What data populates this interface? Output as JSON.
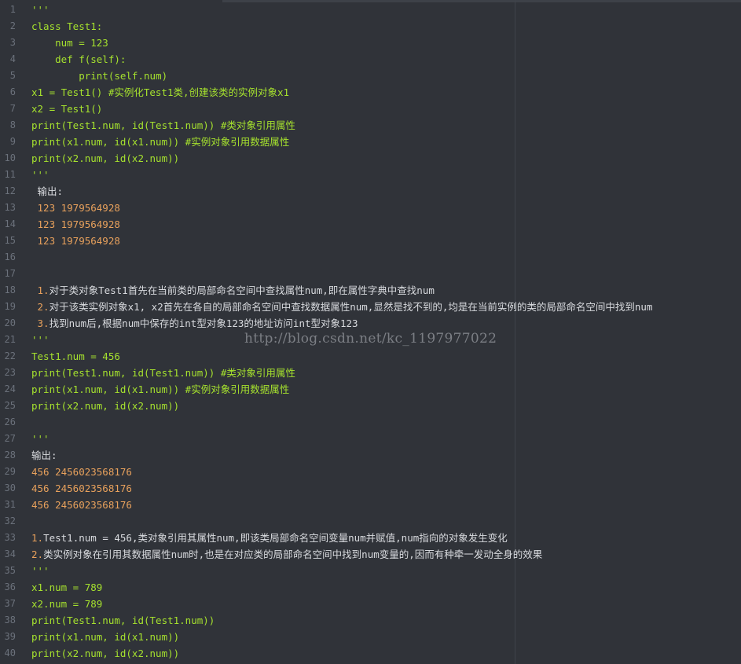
{
  "watermark": "http://blog.csdn.net/kc_1197977022",
  "lines": [
    {
      "n": "1",
      "text": "'''",
      "color": "green"
    },
    {
      "n": "2",
      "text": "class Test1:",
      "color": "green"
    },
    {
      "n": "3",
      "text": "    num = 123",
      "color": "green"
    },
    {
      "n": "4",
      "text": "    def f(self):",
      "color": "green"
    },
    {
      "n": "5",
      "text": "        print(self.num)",
      "color": "green"
    },
    {
      "n": "6",
      "text": "x1 = Test1() #实例化Test1类,创建该类的实例对象x1",
      "color": "green"
    },
    {
      "n": "7",
      "text": "x2 = Test1()",
      "color": "green"
    },
    {
      "n": "8",
      "text": "print(Test1.num, id(Test1.num)) #类对象引用属性",
      "color": "green"
    },
    {
      "n": "9",
      "text": "print(x1.num, id(x1.num)) #实例对象引用数据属性",
      "color": "green"
    },
    {
      "n": "10",
      "text": "print(x2.num, id(x2.num))",
      "color": "green"
    },
    {
      "n": "11",
      "text": "'''",
      "color": "green"
    },
    {
      "n": "12",
      "text": " 输出:",
      "color": "white"
    },
    {
      "n": "13",
      "text": " 123 1979564928",
      "color": "orange"
    },
    {
      "n": "14",
      "text": " 123 1979564928",
      "color": "orange"
    },
    {
      "n": "15",
      "text": " 123 1979564928",
      "color": "orange"
    },
    {
      "n": "16",
      "text": "",
      "color": "white"
    },
    {
      "n": "17",
      "text": "",
      "color": "white"
    },
    {
      "n": "18",
      "text": " 1.对于类对象Test1首先在当前类的局部命名空间中查找属性num,即在属性字典中查找num",
      "color": "white",
      "prefix": " 1.",
      "prefix_color": "orange"
    },
    {
      "n": "19",
      "text": " 2.对于该类实例对象x1, x2首先在各自的局部命名空间中查找数据属性num,显然是找不到的,均是在当前实例的类的局部命名空间中找到num",
      "color": "white",
      "prefix": " 2.",
      "prefix_color": "orange"
    },
    {
      "n": "20",
      "text": " 3.找到num后,根据num中保存的int型对象123的地址访问int型对象123",
      "color": "white",
      "prefix": " 3.",
      "prefix_color": "orange"
    },
    {
      "n": "21",
      "text": "'''",
      "color": "green"
    },
    {
      "n": "22",
      "text": "Test1.num = 456",
      "color": "green"
    },
    {
      "n": "23",
      "text": "print(Test1.num, id(Test1.num)) #类对象引用属性",
      "color": "green"
    },
    {
      "n": "24",
      "text": "print(x1.num, id(x1.num)) #实例对象引用数据属性",
      "color": "green"
    },
    {
      "n": "25",
      "text": "print(x2.num, id(x2.num))",
      "color": "green"
    },
    {
      "n": "26",
      "text": "",
      "color": "white"
    },
    {
      "n": "27",
      "text": "'''",
      "color": "green"
    },
    {
      "n": "28",
      "text": "输出:",
      "color": "white"
    },
    {
      "n": "29",
      "text": "456 2456023568176",
      "color": "orange"
    },
    {
      "n": "30",
      "text": "456 2456023568176",
      "color": "orange"
    },
    {
      "n": "31",
      "text": "456 2456023568176",
      "color": "orange"
    },
    {
      "n": "32",
      "text": "",
      "color": "white"
    },
    {
      "n": "33",
      "text": "1.Test1.num = 456,类对象引用其属性num,即该类局部命名空间变量num并赋值,num指向的对象发生变化",
      "color": "white",
      "prefix": "1.",
      "prefix_color": "orange"
    },
    {
      "n": "34",
      "text": "2.类实例对象在引用其数据属性num时,也是在对应类的局部命名空间中找到num变量的,因而有种牵一发动全身的效果",
      "color": "white",
      "prefix": "2.",
      "prefix_color": "orange"
    },
    {
      "n": "35",
      "text": "'''",
      "color": "green"
    },
    {
      "n": "36",
      "text": "x1.num = 789",
      "color": "green"
    },
    {
      "n": "37",
      "text": "x2.num = 789",
      "color": "green"
    },
    {
      "n": "38",
      "text": "print(Test1.num, id(Test1.num))",
      "color": "green"
    },
    {
      "n": "39",
      "text": "print(x1.num, id(x1.num))",
      "color": "green"
    },
    {
      "n": "40",
      "text": "print(x2.num, id(x2.num))",
      "color": "green"
    }
  ],
  "colors": {
    "background": "#303339",
    "line_number": "#6b717b",
    "green": "#a6e22e",
    "orange": "#e8a15c",
    "white": "#d8dade"
  }
}
